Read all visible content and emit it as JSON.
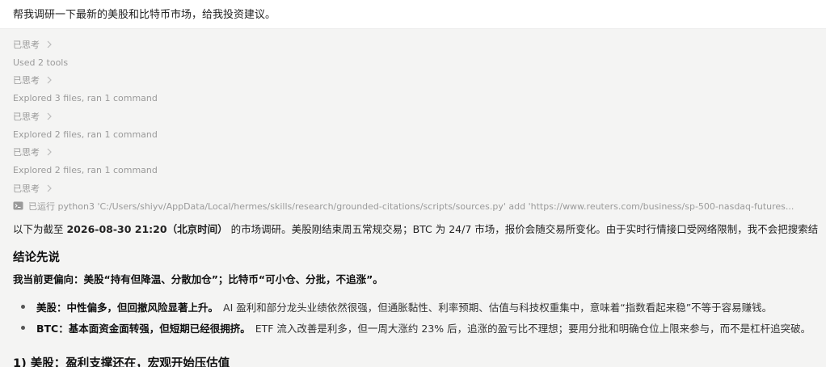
{
  "prompt": "帮我调研一下最新的美股和比特币市场，给我投资建议。",
  "steps": [
    {
      "label": "已思考",
      "chevron": true
    },
    {
      "label": "Used 2 tools",
      "chevron": false
    },
    {
      "label": "已思考",
      "chevron": true
    },
    {
      "label": "Explored 3 files, ran 1 command",
      "chevron": false
    },
    {
      "label": "已思考",
      "chevron": true
    },
    {
      "label": "Explored 2 files, ran 1 command",
      "chevron": false
    },
    {
      "label": "已思考",
      "chevron": true
    },
    {
      "label": "Explored 2 files, ran 1 command",
      "chevron": false
    },
    {
      "label": "已思考",
      "chevron": true
    }
  ],
  "command_step": "已运行 python3 'C:/Users/shiyv/AppData/Local/hermes/skills/research/grounded-citations/scripts/sources.py' add 'https://www.reuters.com/business/sp-500-nasdaq-futures...",
  "intro": {
    "prefix": "以下为截至 ",
    "datetime": "2026-08-30 21:20（北京时间）",
    "suffix": " 的市场调研。美股刚结束周五常规交易；BTC 为 24/7 市场，报价会随交易所变化。由于实时行情接口受网络限制，我不会把搜索结"
  },
  "conclusion_heading": "结论先说",
  "lean": "我当前更偏向：美股“持有但降温、分散加仓”；比特币“可小仓、分批，不追涨”。",
  "bullets": [
    {
      "lead": "美股：中性偏多，但回撤风险显著上升。",
      "text": "AI 盈利和部分龙头业绩依然很强，但通胀黏性、利率预期、估值与科技权重集中，意味着“指数看起来稳”不等于容易赚钱。"
    },
    {
      "lead": "BTC：基本面资金面转强，但短期已经很拥挤。",
      "text": "ETF 流入改善是利多，但一周大涨约 23% 后，追涨的盈亏比不理想；要用分批和明确仓位上限来参与，而不是杠杆追突破。"
    }
  ],
  "section1_heading": "1) 美股：盈利支撑还在，宏观开始压估值"
}
